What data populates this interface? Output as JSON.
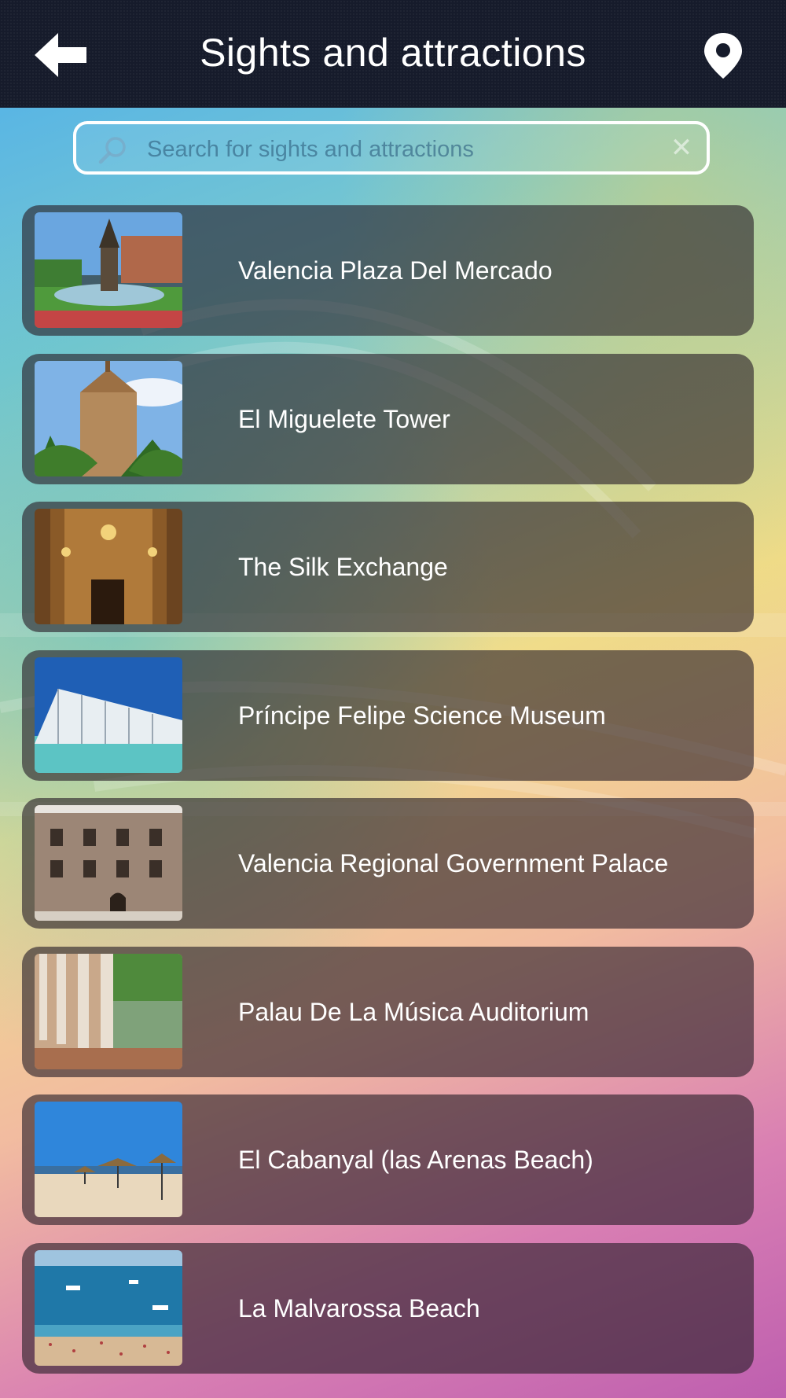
{
  "header": {
    "title": "Sights and attractions",
    "back_icon": "back-arrow-icon",
    "map_icon": "map-pin-icon"
  },
  "search": {
    "placeholder": "Search for sights and attractions",
    "value": "",
    "icon": "search-icon",
    "clear_icon": "clear-icon"
  },
  "colors": {
    "topbar": "#161b2b",
    "card": "#281e28"
  },
  "items": [
    {
      "label": "Valencia Plaza Del Mercado",
      "thumb": "plaza-fountain-statue"
    },
    {
      "label": "El Miguelete Tower",
      "thumb": "bell-tower-palms"
    },
    {
      "label": "The Silk Exchange",
      "thumb": "gothic-hall-interior"
    },
    {
      "label": "Príncipe Felipe Science Museum",
      "thumb": "white-ribbed-museum"
    },
    {
      "label": "Valencia Regional Government Palace",
      "thumb": "stone-palace-facade"
    },
    {
      "label": "Palau De La Música Auditorium",
      "thumb": "colonnade-pool"
    },
    {
      "label": "El Cabanyal (las Arenas Beach)",
      "thumb": "beach-umbrellas"
    },
    {
      "label": "La Malvarossa Beach",
      "thumb": "crowded-beach-boats"
    }
  ]
}
